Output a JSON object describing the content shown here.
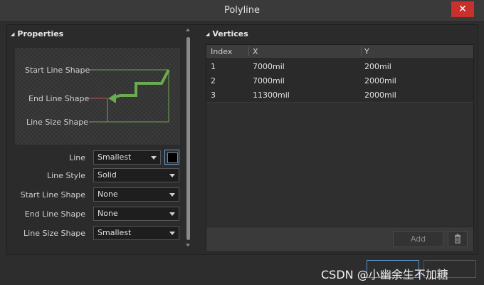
{
  "window": {
    "title": "Polyline",
    "close_glyph": "✕"
  },
  "properties": {
    "header": "Properties",
    "preview": {
      "start_line_shape": "Start Line Shape",
      "end_line_shape": "End Line Shape",
      "line_size_shape": "Line Size Shape",
      "line_color": "#6aaa50",
      "end_marker_color": "#c0504d"
    },
    "fields": [
      {
        "label": "Line",
        "value": "Smallest"
      },
      {
        "label": "Line Style",
        "value": "Solid"
      },
      {
        "label": "Start Line Shape",
        "value": "None"
      },
      {
        "label": "End Line Shape",
        "value": "None"
      },
      {
        "label": "Line Size Shape",
        "value": "Smallest"
      }
    ],
    "line_color_swatch": "#000000"
  },
  "vertices": {
    "header": "Vertices",
    "columns": [
      "Index",
      "X",
      "Y"
    ],
    "rows": [
      [
        "1",
        "7000mil",
        "200mil"
      ],
      [
        "2",
        "7000mil",
        "2000mil"
      ],
      [
        "3",
        "11300mil",
        "2000mil"
      ]
    ],
    "add_label": "Add",
    "trash_icon": "trash-icon"
  },
  "watermark": "CSDN @小幽余生不加糖"
}
